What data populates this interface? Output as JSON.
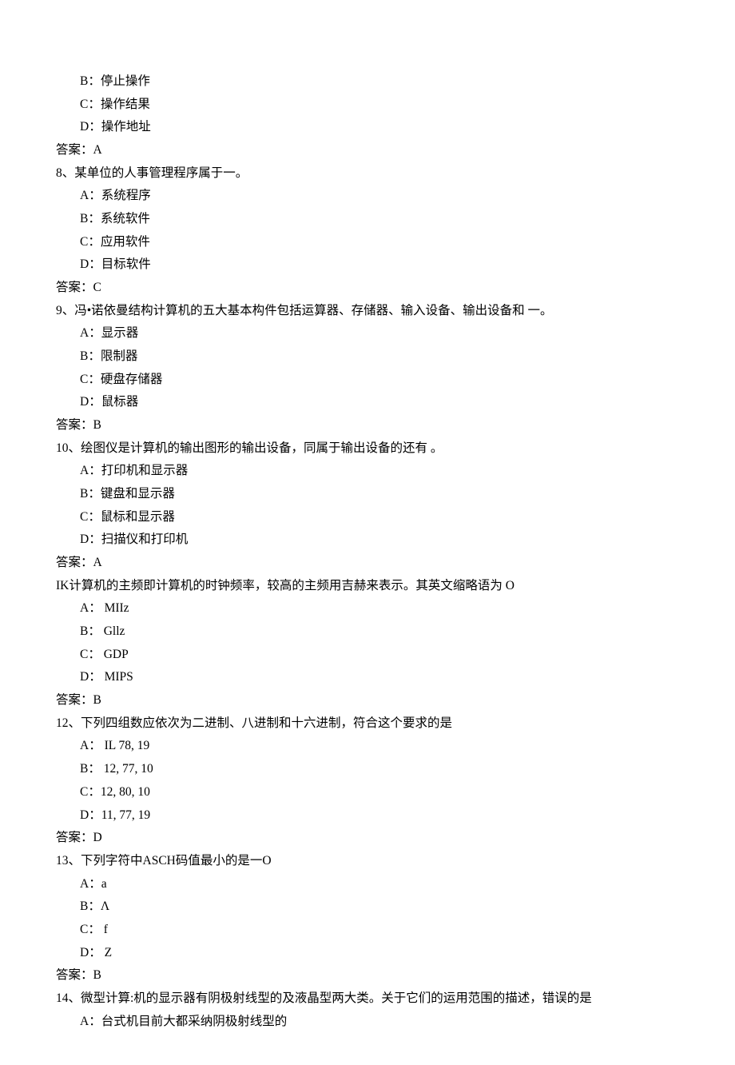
{
  "lines": [
    {
      "cls": "opt",
      "text": "B：停止操作"
    },
    {
      "cls": "opt",
      "text": "C：操作结果"
    },
    {
      "cls": "opt",
      "text": "D：操作地址"
    },
    {
      "cls": "ans",
      "text": "答案：A"
    },
    {
      "cls": "q",
      "text": "8、某单位的人事管理程序属于一。"
    },
    {
      "cls": "opt",
      "text": "A：系统程序"
    },
    {
      "cls": "opt",
      "text": "B：系统软件"
    },
    {
      "cls": "opt",
      "text": "C：应用软件"
    },
    {
      "cls": "opt",
      "text": "D：目标软件"
    },
    {
      "cls": "ans",
      "text": "答案：C"
    },
    {
      "cls": "q",
      "text": "9、冯•诺依曼结构计算机的五大基本构件包括运算器、存储器、输入设备、输出设备和 一。"
    },
    {
      "cls": "opt",
      "text": "A：显示器"
    },
    {
      "cls": "opt",
      "text": "B：限制器"
    },
    {
      "cls": "opt",
      "text": "C：硬盘存储器"
    },
    {
      "cls": "opt",
      "text": "D：鼠标器"
    },
    {
      "cls": "ans",
      "text": "答案：B"
    },
    {
      "cls": "q",
      "text": "10、绘图仪是计算机的输出图形的输出设备，同属于输出设备的还有 。"
    },
    {
      "cls": "opt",
      "text": "A：打印机和显示器"
    },
    {
      "cls": "opt",
      "text": "B：键盘和显示器"
    },
    {
      "cls": "opt",
      "text": "C：鼠标和显示器"
    },
    {
      "cls": "opt",
      "text": "D：扫描仪和打印机"
    },
    {
      "cls": "ans",
      "text": "答案：A"
    },
    {
      "cls": "q",
      "text": "IK计算机的主频即计算机的时钟频率，较高的主频用吉赫来表示。其英文缩略语为 O"
    },
    {
      "cls": "opt",
      "text": "A：  MIIz"
    },
    {
      "cls": "opt",
      "text": "B：  Gllz"
    },
    {
      "cls": "opt",
      "text": "C：  GDP"
    },
    {
      "cls": "opt",
      "text": "D：  MIPS"
    },
    {
      "cls": "ans",
      "text": "答案：B"
    },
    {
      "cls": "q",
      "text": "12、下列四组数应依次为二进制、八进制和十六进制，符合这个要求的是"
    },
    {
      "cls": "opt",
      "text": "A：  IL 78, 19"
    },
    {
      "cls": "opt",
      "text": "B：  12, 77, 10"
    },
    {
      "cls": "opt",
      "text": "C：12, 80, 10"
    },
    {
      "cls": "opt",
      "text": "D：11, 77, 19"
    },
    {
      "cls": "ans",
      "text": "答案：D"
    },
    {
      "cls": "q",
      "text": "13、下列字符中ASCH码值最小的是一O"
    },
    {
      "cls": "opt",
      "text": "A：a"
    },
    {
      "cls": "opt",
      "text": "B：Λ"
    },
    {
      "cls": "opt",
      "text": "C： f"
    },
    {
      "cls": "opt",
      "text": "D：  Z"
    },
    {
      "cls": "ans",
      "text": "答案：B"
    },
    {
      "cls": "q14-wrap",
      "text": "14、微型计算:机的显示器有阴极射线型的及液晶型两大类。关于它们的运用范围的描述，错误的是"
    },
    {
      "cls": "opt",
      "text": "A：台式机目前大都采纳阴极射线型的"
    }
  ]
}
